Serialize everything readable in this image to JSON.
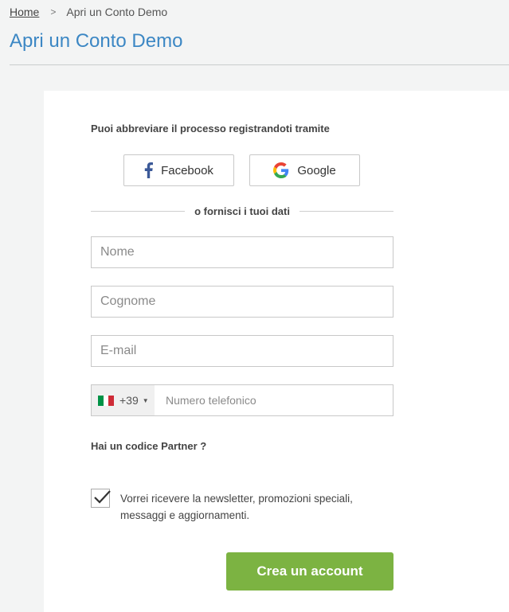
{
  "breadcrumb": {
    "home": "Home",
    "separator": ">",
    "current": "Apri un Conto Demo"
  },
  "page_title": "Apri un Conto Demo",
  "form": {
    "intro": "Puoi abbreviare il processo registrandoti tramite",
    "social": {
      "facebook_label": "Facebook",
      "google_label": "Google"
    },
    "divider_text": "o fornisci i tuoi dati",
    "fields": {
      "nome_placeholder": "Nome",
      "cognome_placeholder": "Cognome",
      "email_placeholder": "E-mail",
      "phone_placeholder": "Numero telefonico"
    },
    "phone_country": {
      "flag_icon": "italy-flag-icon",
      "dial_code": "+39"
    },
    "partner_link": "Hai un codice Partner ?",
    "newsletter": {
      "checked": true,
      "label": "Vorrei ricevere la newsletter, promozioni speciali, messaggi e aggiornamenti."
    },
    "submit_label": "Crea un account"
  },
  "colors": {
    "title_blue": "#3c87c4",
    "button_green": "#7cb342",
    "facebook_blue": "#3b5998",
    "flag_green": "#009246",
    "flag_red": "#ce2b37"
  }
}
